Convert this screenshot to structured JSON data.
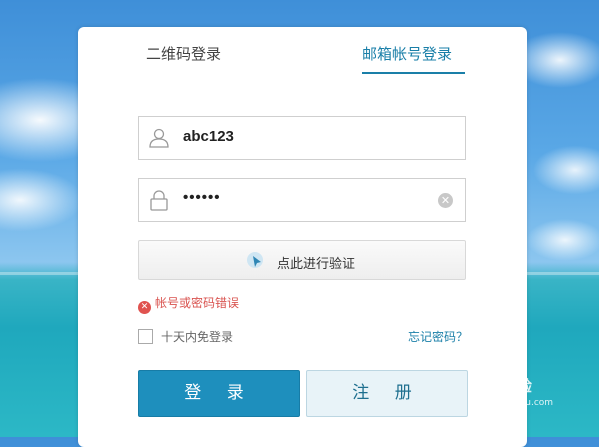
{
  "tabs": {
    "qr_login": "二维码登录",
    "email_login": "邮箱帐号登录"
  },
  "username": {
    "value": "abc123",
    "icon": "user-icon"
  },
  "password": {
    "value": "••••••",
    "icon": "lock-icon",
    "clear_icon": "clear-icon"
  },
  "verify": {
    "label": "点此进行验证",
    "icon": "cursor-click-icon"
  },
  "error": {
    "message": "帐号或密码错误",
    "icon": "error-icon",
    "color": "#d9534f"
  },
  "remember": {
    "label": "十天内免登录",
    "checked": false
  },
  "forgot": {
    "label": "忘记密码？"
  },
  "buttons": {
    "login": "登 录",
    "register": "注 册"
  },
  "watermark": {
    "brand": "Bai 经验",
    "url": "jingyan.baidu.com"
  },
  "colors": {
    "accent": "#1a7fa8",
    "login_button": "#1e8fbd",
    "register_button": "#e8f3f8"
  }
}
